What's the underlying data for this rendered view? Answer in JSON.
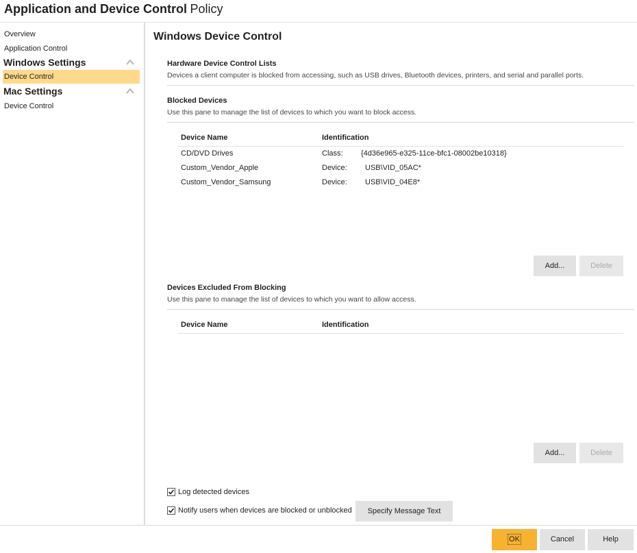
{
  "window": {
    "title_bold": "Application and Device Control",
    "title_light": "Policy"
  },
  "sidebar": {
    "overview": "Overview",
    "application_control": "Application Control",
    "windows_settings": "Windows Settings",
    "windows_device_control": "Device Control",
    "mac_settings": "Mac Settings",
    "mac_device_control": "Device Control"
  },
  "main": {
    "title": "Windows Device Control",
    "hardware": {
      "title": "Hardware Device Control Lists",
      "desc": "Devices a client computer is blocked from accessing, such as USB drives, Bluetooth devices, printers, and serial and parallel ports."
    },
    "blocked": {
      "title": "Blocked Devices",
      "desc": "Use this pane to manage the list of devices to which you want to block access.",
      "col_name": "Device Name",
      "col_id": "Identification",
      "rows": [
        {
          "name": "CD/DVD Drives",
          "type": "Class:",
          "value": "{4d36e965-e325-11ce-bfc1-08002be10318}"
        },
        {
          "name": "Custom_Vendor_Apple",
          "type": "Device:",
          "value": "USB\\VID_05AC*"
        },
        {
          "name": "Custom_Vendor_Samsung",
          "type": "Device:",
          "value": "USB\\VID_04E8*"
        }
      ],
      "add_label": "Add...",
      "delete_label": "Delete"
    },
    "excluded": {
      "title": "Devices Excluded From Blocking",
      "desc": "Use this pane to manage the list of devices to which you want to allow access.",
      "col_name": "Device Name",
      "col_id": "Identification",
      "add_label": "Add...",
      "delete_label": "Delete"
    },
    "log_label": "Log detected devices",
    "log_checked": true,
    "notify_label": "Notify users when devices are blocked or unblocked",
    "notify_checked": true,
    "specify_label": "Specify Message Text"
  },
  "footer": {
    "ok_label": "OK",
    "cancel_label": "Cancel",
    "help_label": "Help"
  },
  "colors": {
    "selected_nav": "#ffd98a",
    "primary_button": "#f8b230",
    "button_gray": "#e2e2e2"
  }
}
